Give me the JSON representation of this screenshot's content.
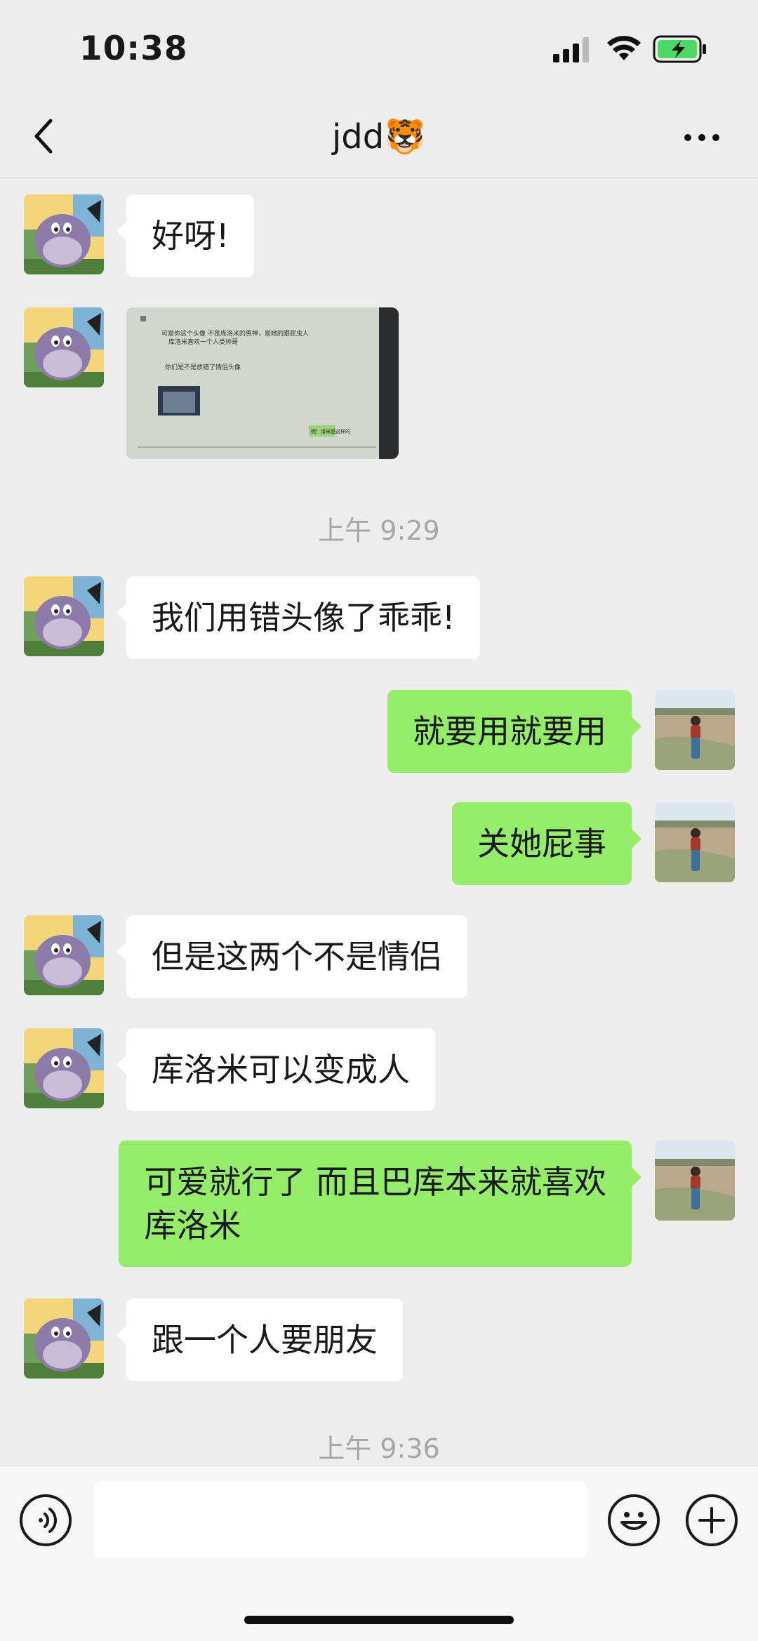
{
  "status": {
    "time": "10:38"
  },
  "nav": {
    "title": "jdd🐯"
  },
  "messages": [
    {
      "side": "left",
      "text": "好呀!"
    },
    {
      "side": "left",
      "type": "image",
      "image_text": {
        "line1": "可是你这个头像 不是库洛米的男神，是她的跟屁虫人",
        "line2": "库洛米喜欢一个人类帅哥",
        "line3": "你们是不是放错了情侣头像",
        "line4": "呢！请米是这样的"
      }
    },
    {
      "side": "left",
      "text": "我们用错头像了乖乖!"
    },
    {
      "side": "right",
      "text": "就要用就要用"
    },
    {
      "side": "right",
      "text": "关她屁事"
    },
    {
      "side": "left",
      "text": "但是这两个不是情侣"
    },
    {
      "side": "left",
      "text": "库洛米可以变成人"
    },
    {
      "side": "right",
      "text": "可爱就行了 而且巴库本来就喜欢\n库洛米"
    },
    {
      "side": "left",
      "text": "跟一个人要朋友"
    }
  ],
  "timestamps": [
    "上午 9:29",
    "上午 9:36"
  ],
  "input": {
    "value": ""
  },
  "icons": [
    "back-icon",
    "more-icon",
    "voice-icon",
    "emoji-icon",
    "plus-icon"
  ],
  "colors": {
    "bubble_right": "#95EC69",
    "bubble_left": "#FFFFFF",
    "background": "#EDEDED"
  }
}
